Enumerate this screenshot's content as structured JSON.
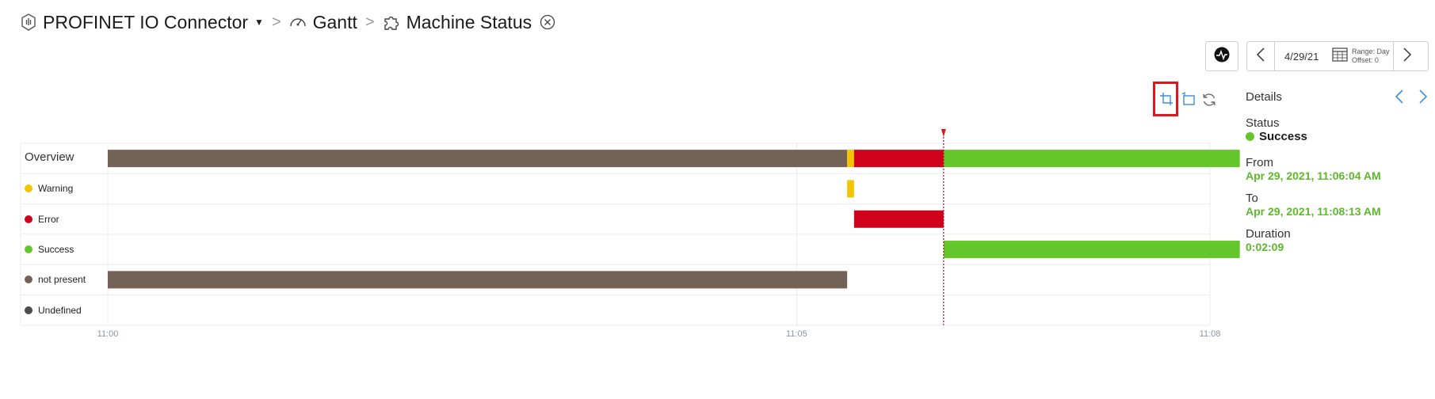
{
  "breadcrumb": {
    "app": "PROFINET IO Connector",
    "dashboard": "Gantt",
    "page": "Machine Status",
    "icons": [
      "plug-icon",
      "gauge-icon",
      "puzzle-icon",
      "close-circle-icon"
    ]
  },
  "toolbar": {
    "date": "4/29/21",
    "range": "Range: Day",
    "offset": "Offset: 0"
  },
  "chart_data": {
    "type": "gantt",
    "time_axis": {
      "start": "11:00",
      "end": "11:08",
      "ticks": [
        "11:00",
        "11:05",
        "11:08"
      ]
    },
    "overview_label": "Overview",
    "rows": [
      {
        "label": "Warning",
        "color": "#f5c400"
      },
      {
        "label": "Error",
        "color": "#d0021b"
      },
      {
        "label": "Success",
        "color": "#65c62b"
      },
      {
        "label": "not present",
        "color": "#736357"
      },
      {
        "label": "Undefined",
        "color": "#4a4a4a"
      }
    ],
    "segments": [
      {
        "state": "not present",
        "start": "11:00:00",
        "end": "11:05:22"
      },
      {
        "state": "Warning",
        "start": "11:05:22",
        "end": "11:05:25"
      },
      {
        "state": "Error",
        "start": "11:05:25",
        "end": "11:06:04"
      },
      {
        "state": "Success",
        "start": "11:06:04",
        "end": "11:08:13"
      }
    ],
    "marker_time": "11:06:04",
    "grid": true
  },
  "details": {
    "title": "Details",
    "status_label": "Status",
    "status_value": "Success",
    "status_color": "#65c62b",
    "from_label": "From",
    "from_value": "Apr 29, 2021, 11:06:04 AM",
    "to_label": "To",
    "to_value": "Apr 29, 2021, 11:08:13 AM",
    "duration_label": "Duration",
    "duration_value": "0:02:09"
  }
}
